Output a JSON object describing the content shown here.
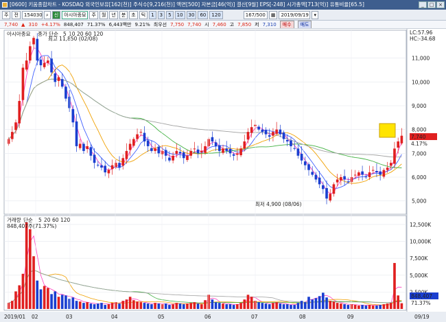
{
  "window": {
    "title": "[0600] 키움종합차트 - KOSDAQ 외국인보유[162(천)] 주식수[9,216(천)] 액면[500] 자본금[46(억)] 결산[9월] EPS[-248] 시가총액[713(억)] 유통비율[65.5]",
    "buttons": [
      "_",
      "□",
      "×"
    ]
  },
  "toolbar": {
    "period": "주",
    "type": "전",
    "code": "154030",
    "stock_badge": "신",
    "stock_name": "아시아종묘",
    "tabs": [
      "주",
      "월",
      "년",
      "분",
      "초",
      "틱"
    ],
    "numbers": [
      "1",
      "3",
      "5",
      "10",
      "30",
      "60",
      "120"
    ],
    "count": "167/500",
    "date": "2019/09/19"
  },
  "infobar": {
    "price": "7,740",
    "arrow": "▲",
    "change": "310",
    "rate": "+4.17%",
    "volume": "848,407",
    "vol_rate": "71.37%",
    "turnover": "6,443백만",
    "turnover_rate": "9.21%",
    "prev_label": "최우선",
    "prev_val": "7,750",
    "prev_val2": "7,740",
    "high_label": "시",
    "open": "7,460",
    "high_label2": "고",
    "high": "7,850",
    "low_label": "저",
    "low": "7,310",
    "buy": "매수",
    "sell": "매도"
  },
  "price_panel": {
    "stock_label": "아시아종묘",
    "ma_label": "종가 단순",
    "ma_periods": [
      "5",
      "10",
      "20",
      "60",
      "120"
    ],
    "lc_label": "LC:57.96",
    "hc_label": "HC:-34.68",
    "high_annot": "최고 11,850 (02/08)",
    "low_annot": "최저 4,900 (08/06)",
    "current_price": "7,740",
    "current_rate": "4.17%",
    "y_ticks": [
      "11,000",
      "10,000",
      "9,000",
      "8,000",
      "7,000",
      "6,000",
      "5,000"
    ],
    "y_min": 4500,
    "y_max": 12000
  },
  "volume_panel": {
    "label": "거래량",
    "ma_label": "단순",
    "ma_periods": [
      "5",
      "20",
      "60",
      "120"
    ],
    "current": "848,407주(71.37%)",
    "y_ticks": [
      "12,500K",
      "10,000K",
      "7,500K",
      "5,000K",
      "2,500K"
    ],
    "current_vol": "848,407",
    "current_vol_rate": "71.37%"
  },
  "x_axis": {
    "labels": [
      "2019/01",
      "02",
      "03",
      "04",
      "05",
      "06",
      "07",
      "08",
      "09"
    ],
    "right_label": "09/19"
  },
  "colors": {
    "up": "#e02020",
    "down": "#1a3fd0",
    "ma5": "#ff40c0",
    "ma10": "#4060ff",
    "ma20": "#f0a000",
    "ma60": "#40b040",
    "ma120": "#a0a0a0",
    "current_box": "#ffe400"
  },
  "chart_data": {
    "type": "candlestick",
    "note_days_sampled": true,
    "closes": [
      7600,
      7900,
      8300,
      9200,
      10600,
      10900,
      11500,
      11850,
      10900,
      10700,
      10800,
      10900,
      10400,
      10000,
      10200,
      9800,
      9300,
      8900,
      8300,
      7300,
      7400,
      7100,
      7300,
      6900,
      6600,
      6500,
      6400,
      6200,
      6300,
      6500,
      6600,
      6400,
      6800,
      7100,
      7400,
      7600,
      7800,
      7900,
      7500,
      7300,
      7100,
      7200,
      7000,
      7100,
      6900,
      6700,
      6900,
      7100,
      7000,
      6800,
      6900,
      7100,
      7200,
      7000,
      7100,
      7300,
      7600,
      7500,
      7300,
      7100,
      7200,
      7100,
      7000,
      6900,
      7000,
      7200,
      7500,
      7900,
      8100,
      8200,
      8000,
      7900,
      7800,
      7700,
      7900,
      8000,
      7800,
      7600,
      7500,
      7300,
      7200,
      6900,
      6700,
      6500,
      6300,
      6100,
      5900,
      5700,
      5500,
      5100,
      5300,
      5700,
      5900,
      6000,
      5900,
      5800,
      6000,
      6100,
      6200,
      6100,
      6000,
      6200,
      6300,
      6200,
      6100,
      6300,
      6400,
      6600,
      7200,
      7500,
      7740
    ],
    "volumes": [
      900,
      1200,
      2600,
      3500,
      5200,
      12800,
      11800,
      7800,
      4200,
      2900,
      3400,
      3100,
      2200,
      2600,
      1800,
      2100,
      2000,
      1500,
      1700,
      1200,
      1100,
      900,
      1000,
      800,
      700,
      800,
      900,
      600,
      700,
      900,
      1000,
      800,
      1200,
      1400,
      1800,
      1300,
      1100,
      1000,
      900,
      800,
      700,
      900,
      800,
      700,
      800,
      600,
      700,
      900,
      800,
      700,
      800,
      900,
      1000,
      800,
      700,
      1300,
      2100,
      1400,
      1000,
      900,
      800,
      700,
      700,
      600,
      700,
      900,
      1400,
      2100,
      1800,
      1200,
      1000,
      900,
      800,
      700,
      900,
      1000,
      800,
      700,
      700,
      600,
      600,
      900,
      1200,
      1000,
      1800,
      1400,
      1600,
      1900,
      2400,
      1700,
      1200,
      1100,
      900,
      800,
      700,
      600,
      700,
      600,
      500,
      600,
      500,
      600,
      500,
      500,
      600,
      700,
      800,
      900,
      6800,
      2000,
      848
    ]
  }
}
